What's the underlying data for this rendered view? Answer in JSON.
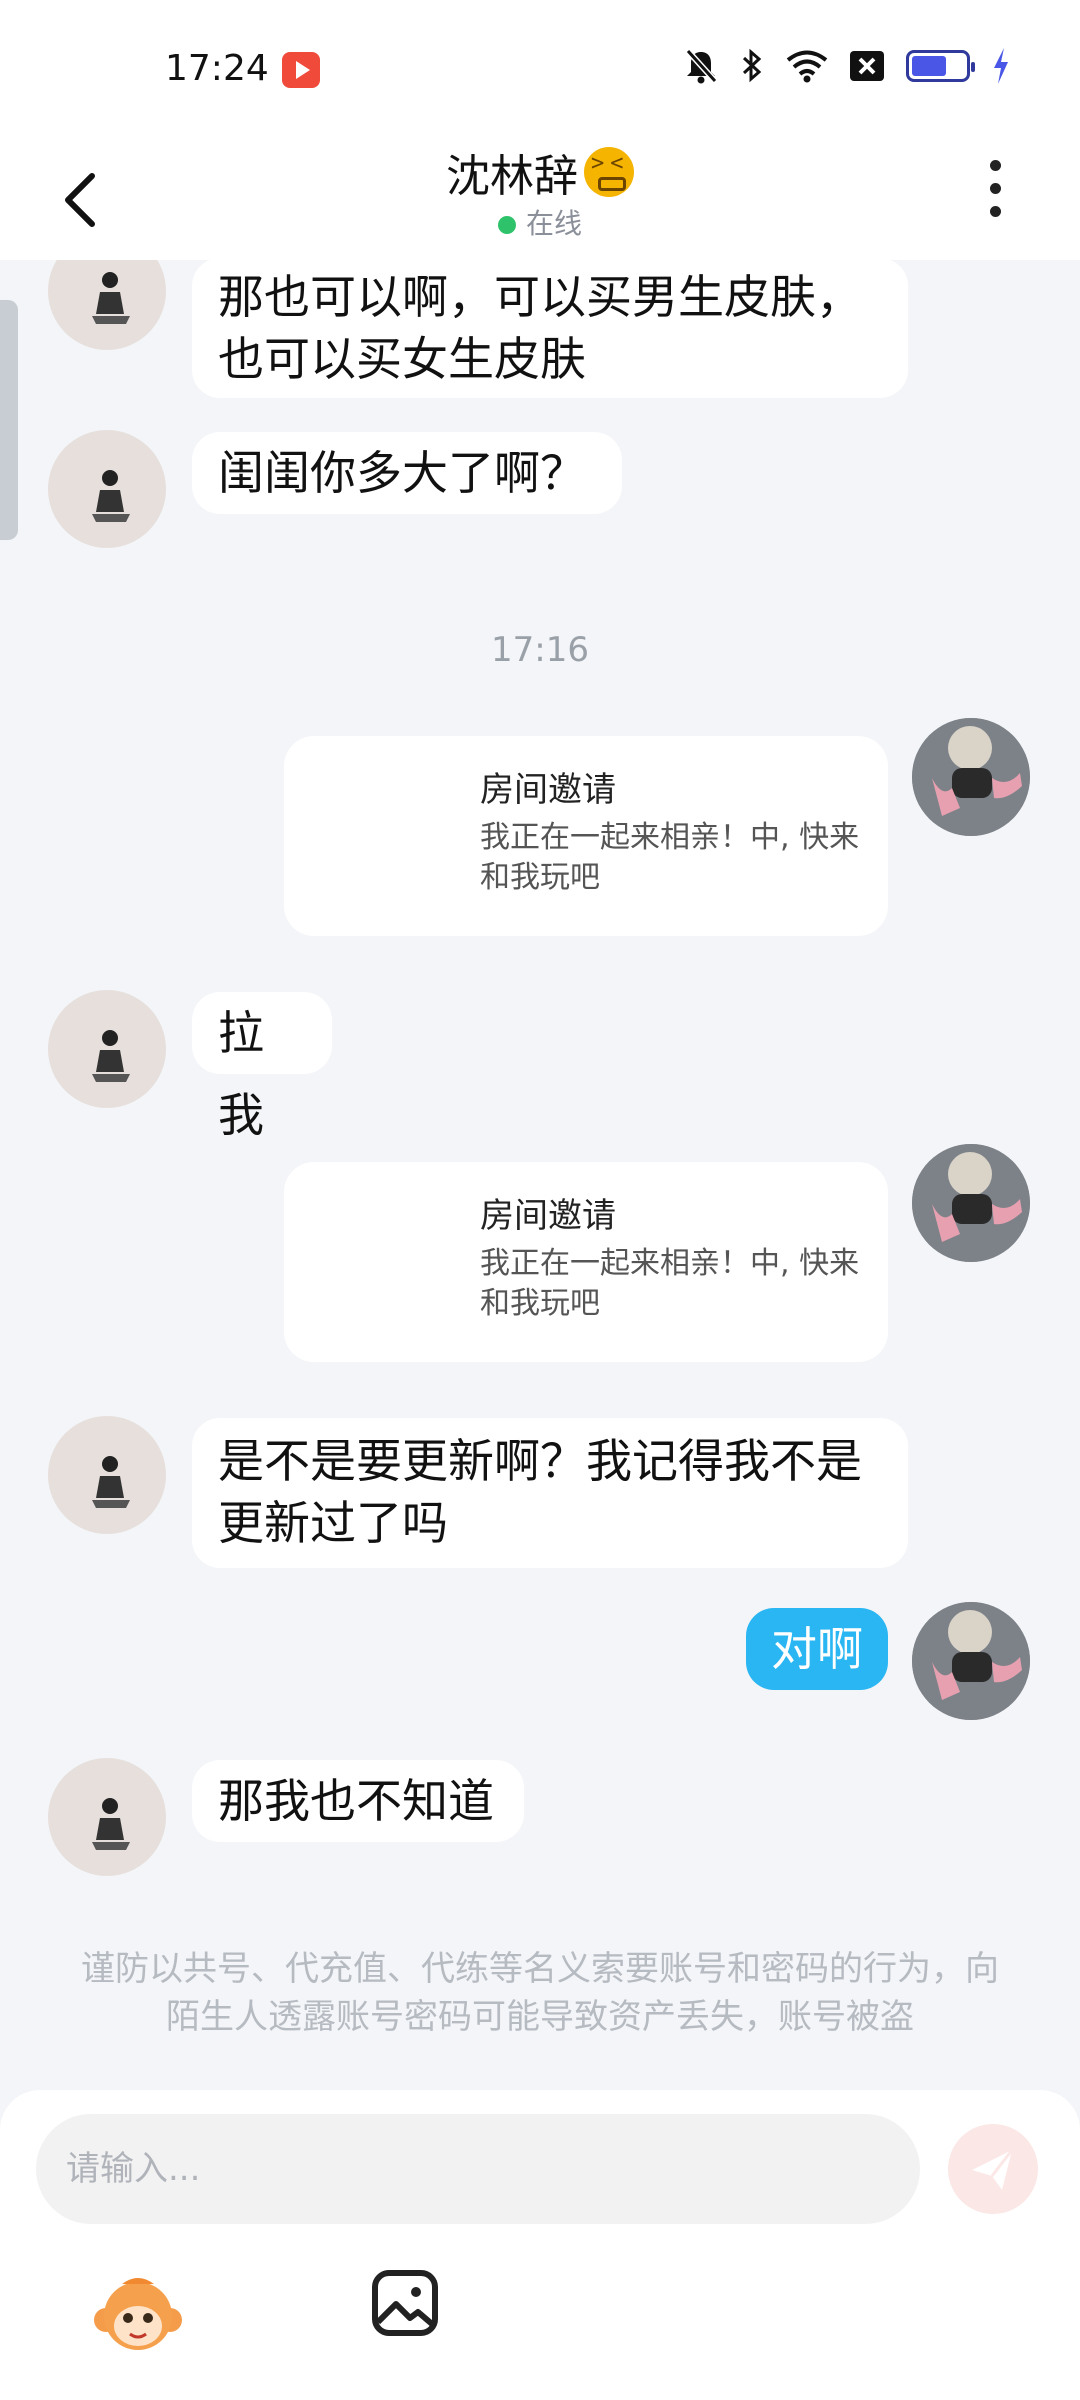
{
  "status_bar": {
    "time": "17:24",
    "icons": [
      "video-app-icon",
      "mute-bell-icon",
      "bluetooth-icon",
      "wifi-icon",
      "sim-off-icon",
      "battery-icon",
      "charging-icon"
    ],
    "battery_level": 0.55
  },
  "header": {
    "title": "沈林辞",
    "title_emoji": "confounded-face-emoji",
    "status": "在线",
    "status_color": "#2ec36b"
  },
  "messages": [
    {
      "from": "other",
      "text": "那也可以啊，可以买男生皮肤，也可以买女生皮肤"
    },
    {
      "from": "other",
      "text": "闺闺你多大了啊？"
    },
    {
      "type": "time",
      "text": "17:16"
    },
    {
      "from": "self",
      "type": "card",
      "title": "房间邀请",
      "text": "我正在一起来相亲！中, 快来和我玩吧"
    },
    {
      "from": "other",
      "text": "拉我"
    },
    {
      "from": "self",
      "type": "card",
      "title": "房间邀请",
      "text": "我正在一起来相亲！中, 快来和我玩吧"
    },
    {
      "from": "other",
      "text": "是不是要更新啊？我记得我不是更新过了吗"
    },
    {
      "from": "self",
      "text": "对啊"
    },
    {
      "from": "other",
      "text": "那我也不知道"
    }
  ],
  "notice": "谨防以共号、代充值、代练等名义索要账号和密码的行为，向陌生人透露账号密码可能导致资产丢失，账号被盗",
  "input": {
    "placeholder": "请输入..."
  },
  "colors": {
    "self_bubble": "#2ab6f2",
    "background": "#f3f5f8"
  }
}
